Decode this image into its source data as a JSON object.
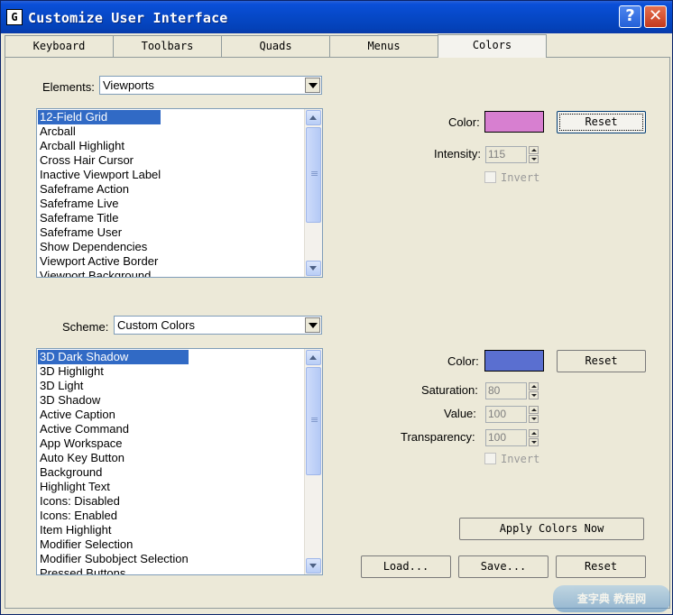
{
  "window": {
    "title": "Customize User Interface",
    "app_icon": "G",
    "help_label": "?",
    "close_label": "✕"
  },
  "tabs": [
    {
      "label": "Keyboard"
    },
    {
      "label": "Toolbars"
    },
    {
      "label": "Quads"
    },
    {
      "label": "Menus"
    },
    {
      "label": "Colors"
    }
  ],
  "active_tab": "Colors",
  "elements": {
    "label": "Elements:",
    "value": "Viewports",
    "items": [
      "12-Field Grid",
      "Arcball",
      "Arcball Highlight",
      "Cross Hair Cursor",
      "Inactive Viewport Label",
      "Safeframe Action",
      "Safeframe Live",
      "Safeframe Title",
      "Safeframe User",
      "Show Dependencies",
      "Viewport Active Border",
      "Viewport Background"
    ],
    "selected_index": 0
  },
  "element_color": {
    "color_label": "Color:",
    "color": "#d77fd0",
    "reset_label": "Reset",
    "intensity_label": "Intensity:",
    "intensity_value": "115",
    "invert_label": "Invert",
    "invert_checked": false
  },
  "scheme": {
    "label": "Scheme:",
    "value": "Custom Colors",
    "items": [
      "3D Dark Shadow",
      "3D Highlight",
      "3D Light",
      "3D Shadow",
      "Active Caption",
      "Active Command",
      "App Workspace",
      "Auto Key Button",
      "Background",
      "Highlight Text",
      "Icons: Disabled",
      "Icons: Enabled",
      "Item Highlight",
      "Modifier Selection",
      "Modifier Subobject Selection",
      "Pressed Buttons"
    ],
    "selected_index": 0
  },
  "scheme_color": {
    "color_label": "Color:",
    "color": "#5a6fd0",
    "reset_label": "Reset",
    "saturation_label": "Saturation:",
    "saturation_value": "80",
    "value_label": "Value:",
    "value_value": "100",
    "transparency_label": "Transparency:",
    "transparency_value": "100",
    "invert_label": "Invert",
    "invert_checked": false
  },
  "buttons": {
    "apply": "Apply Colors Now",
    "load": "Load...",
    "save": "Save...",
    "reset": "Reset"
  },
  "colors": {
    "title_bar": "#0648c6",
    "selection": "#316ac5",
    "dialog_bg": "#ece9d8"
  },
  "watermark": {
    "text": "查字典 教程网"
  }
}
